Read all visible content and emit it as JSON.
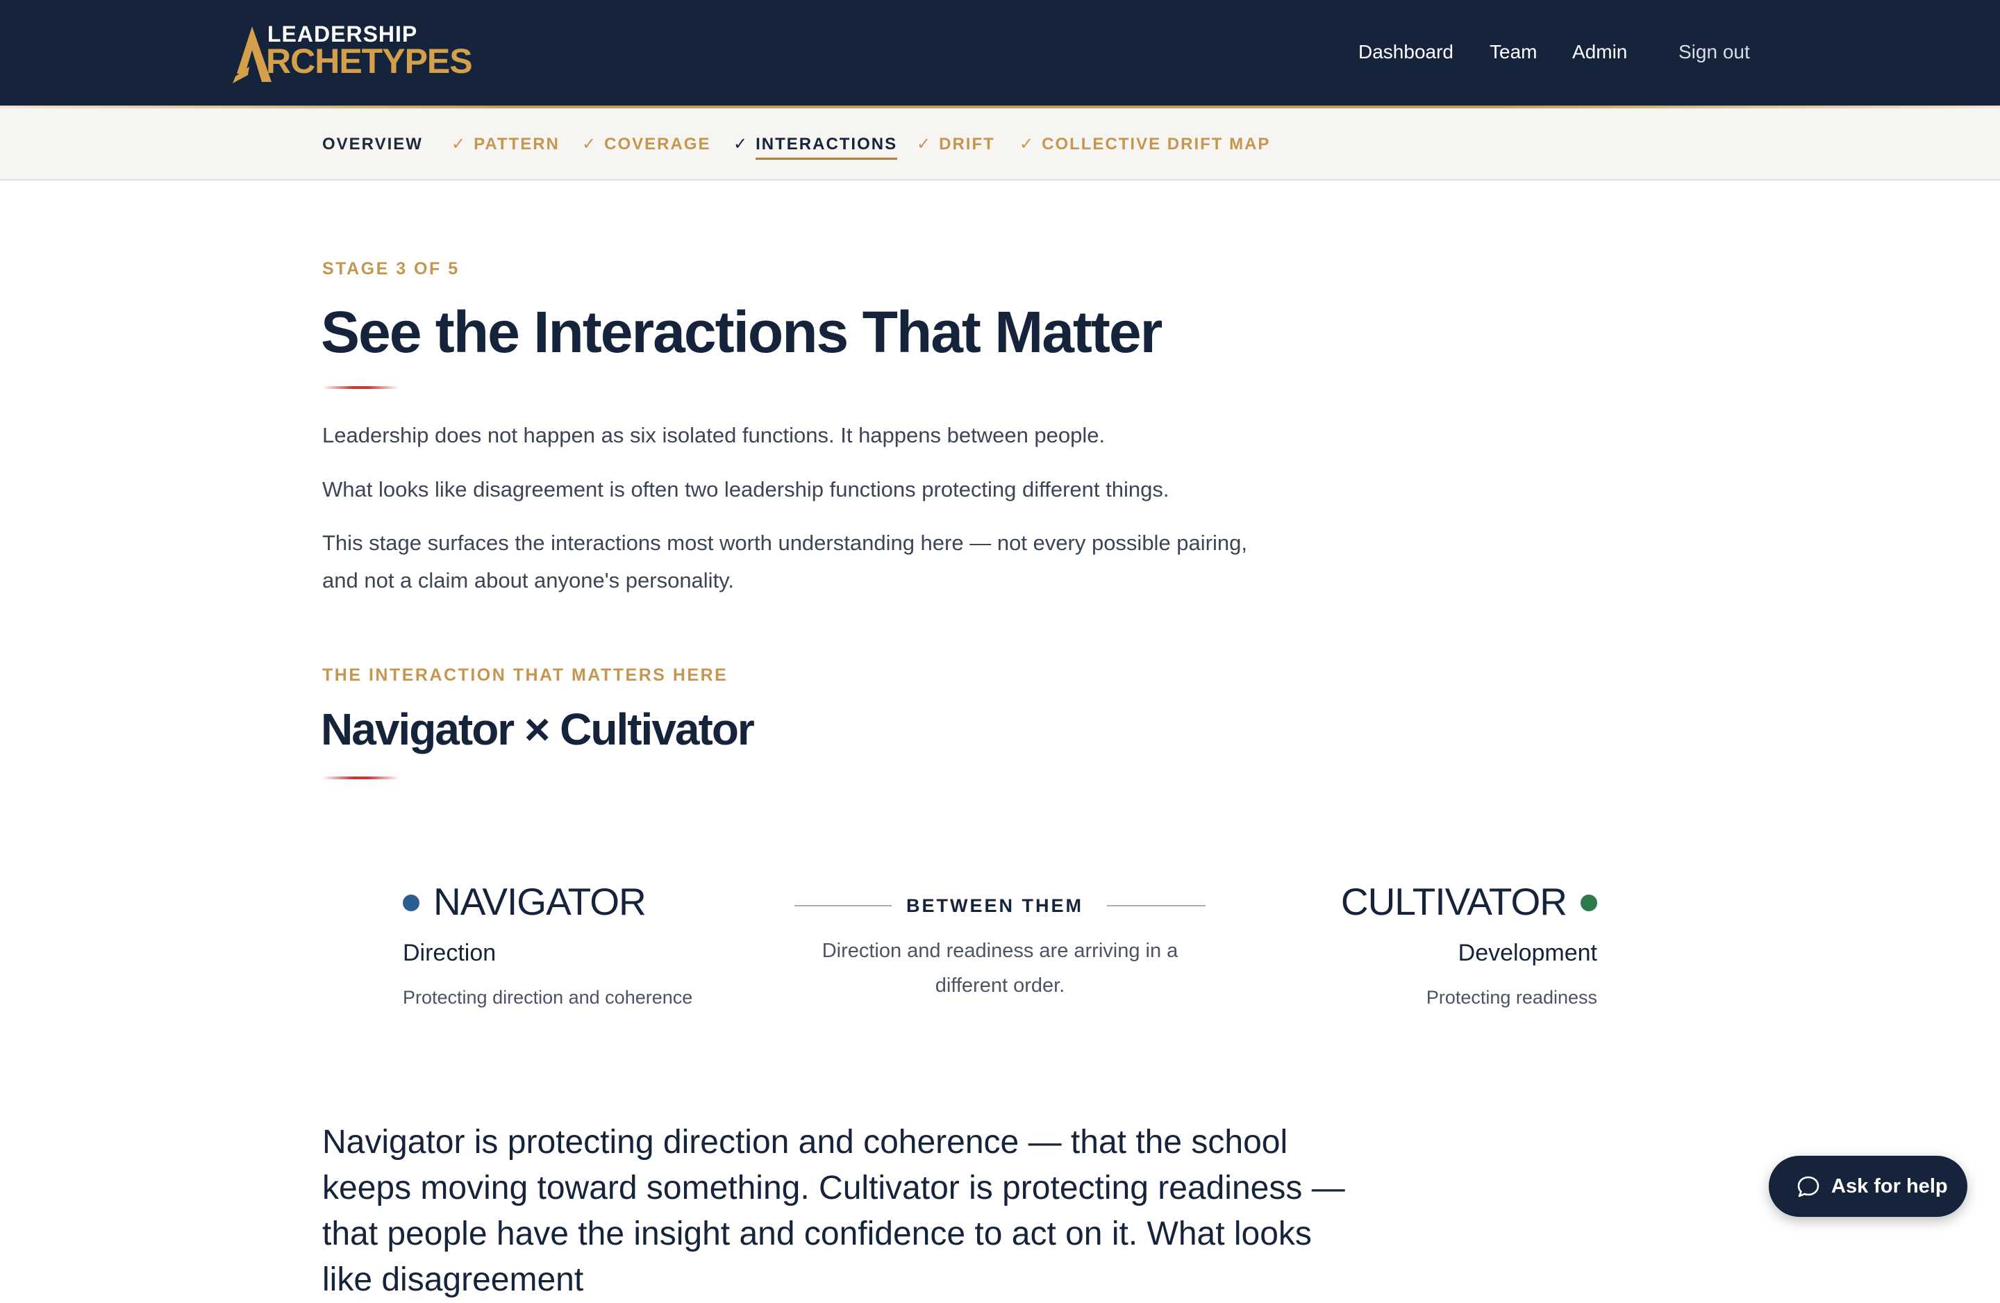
{
  "header": {
    "logo_top": "LEADERSHIP",
    "logo_bottom": "RCHETYPES",
    "nav": [
      "Dashboard",
      "Team",
      "Admin"
    ],
    "sign_out": "Sign out"
  },
  "stages": {
    "tabs": [
      {
        "label": "OVERVIEW",
        "check": "",
        "state": "default"
      },
      {
        "label": "PATTERN",
        "check": "✓",
        "state": "complete"
      },
      {
        "label": "COVERAGE",
        "check": "✓",
        "state": "complete"
      },
      {
        "label": "INTERACTIONS",
        "check": "✓",
        "state": "active"
      },
      {
        "label": "DRIFT",
        "check": "✓",
        "state": "complete"
      },
      {
        "label": "COLLECTIVE DRIFT MAP",
        "check": "✓",
        "state": "complete"
      }
    ]
  },
  "intro": {
    "eyebrow": "STAGE 3 OF 5",
    "title": "See the Interactions That Matter",
    "paragraphs": [
      "Leadership does not happen as six isolated functions. It happens between people.",
      "What looks like disagreement is often two leadership functions protecting different things.",
      "This stage surfaces the interactions most worth understanding here — not every possible pairing, and not a claim about anyone's personality."
    ]
  },
  "interaction": {
    "eyebrow": "THE INTERACTION THAT MATTERS HERE",
    "title": "Navigator × Cultivator",
    "left": {
      "name": "NAVIGATOR",
      "function": "Direction",
      "protecting": "Protecting direction and coherence",
      "color": "#2c5d8f"
    },
    "between": {
      "label": "BETWEEN THEM",
      "text": "Direction and readiness are arriving in a different order."
    },
    "right": {
      "name": "CULTIVATOR",
      "function": "Development",
      "protecting": "Protecting readiness",
      "color": "#2e7a4a"
    },
    "lead": "Navigator is protecting direction and coherence — that the school keeps moving toward something. Cultivator is protecting readiness — that people have the insight and confidence to act on it. What looks like disagreement"
  },
  "help": {
    "label": "Ask for help",
    "icon": "chat-bubble-icon"
  },
  "colors": {
    "navy": "#15233b",
    "gold": "#c59650",
    "accent_red": "#c43a30"
  }
}
